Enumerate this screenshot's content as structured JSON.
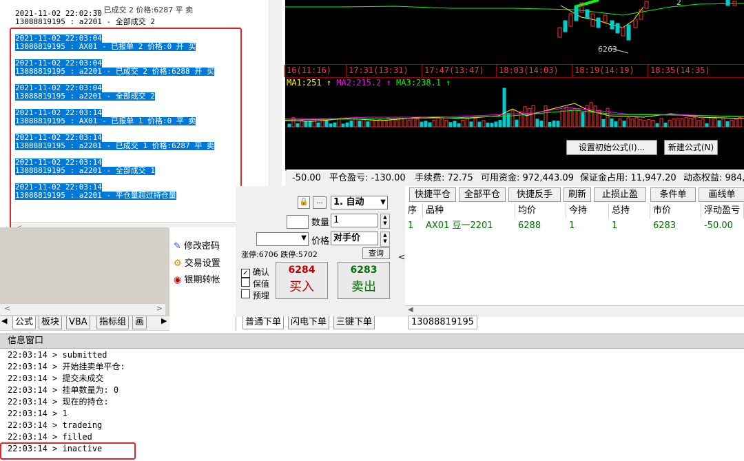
{
  "log_window": {
    "partial_line": "— 已成交 2 价格:6287 平 卖",
    "lines": [
      {
        "time": "2021-11-02 22:02:30",
        "msg": "13088819195 : a2201 - 全部成交 2",
        "selected": false
      },
      {
        "time": "2021-11-02 22:03:04",
        "msg": "13088819195 : AX01 - 已报单 2 价格:0 开 买",
        "selected": true
      },
      {
        "time": "2021-11-02 22:03:04",
        "msg": "13088819195 : a2201 - 已成交 2 价格:6288 开 买",
        "selected": true
      },
      {
        "time": "2021-11-02 22:03:04",
        "msg": "13088819195 : a2201 - 全部成交 2",
        "selected": true
      },
      {
        "time": "2021-11-02 22:03:14",
        "msg": "13088819195 : AX01 - 已报单 1 价格:0 平 卖",
        "selected": true
      },
      {
        "time": "2021-11-02 22:03:14",
        "msg": "13088819195 : a2201 - 已成交 1 价格:6287 平 卖",
        "selected": true
      },
      {
        "time": "2021-11-02 22:03:14",
        "msg": "13088819195 : a2201 - 全部成交 1",
        "selected": true
      },
      {
        "time": "2021-11-02 22:03:14",
        "msg": "13088819195 : a2201 - 平仓量超过持仓量",
        "selected": true
      }
    ]
  },
  "chart": {
    "time_labels": [
      "16(11:16)",
      "17:31(13:31)",
      "17:47(13:47)",
      "18:03(14:03)",
      "18:19(14:19)",
      "18:35(14:35)"
    ],
    "price_labels": [
      "6263",
      "2"
    ],
    "ma": [
      {
        "label": "MA1:251",
        "color": "#ffff00"
      },
      {
        "label": "MA2:215.2",
        "color": "#ff00ff"
      },
      {
        "label": "MA3:238.1",
        "color": "#00ff00"
      }
    ],
    "buttons": {
      "init_formula": "设置初始公式(I)...",
      "new_formula": "新建公式(N)"
    }
  },
  "status_bar": {
    "float_pnl": "-50.00",
    "close_pnl": "平仓盈亏: -130.00",
    "fee": "手续费: 72.75",
    "available": "可用资金: 972,443.09",
    "margin": "保证金占用: 11,947.20",
    "equity": "动态权益: 984,"
  },
  "left_tabs": [
    "公式",
    "板块",
    "VBA",
    "指标组",
    "画"
  ],
  "menu": {
    "items": [
      "修改密码",
      "交易设置",
      "银期转帐"
    ]
  },
  "order_panel": {
    "mode": "1. 自动",
    "qty_label": "数量",
    "qty_value": "1",
    "price_label": "价格",
    "price_value": "对手价",
    "limit_text": "涨停:6706 跌停:5702",
    "query_button": "查询",
    "confirm": "确认",
    "hedge": "保值",
    "preorder": "预埋",
    "buy_price": "6284",
    "buy_label": "买入",
    "sell_price": "6283",
    "sell_label": "卖出",
    "tabs": [
      "普通下单",
      "闪电下单",
      "三键下单"
    ]
  },
  "positions": {
    "buttons": [
      "快捷平仓",
      "全部平仓",
      "快捷反手",
      "刷新",
      "止损止盈",
      "条件单",
      "画线单"
    ],
    "columns": [
      "序",
      "品种",
      "均价",
      "今持",
      "总持",
      "市价",
      "浮动盈亏"
    ],
    "rows": [
      [
        "1",
        "AX01 豆一2201",
        "6288",
        "1",
        "1",
        "6283",
        "-50.00"
      ]
    ],
    "account_tab": "13088819195"
  },
  "info_window": {
    "title": "信息窗口",
    "lines": [
      "22:03:14 > submitted",
      "22:03:14 > 开始挂卖单平仓:",
      "22:03:14 > 提交未成交",
      "22:03:14 > 挂单数量为: 0",
      "22:03:14 > 现在的持仓:",
      "22:03:14 > 1",
      "22:03:14 > tradeing",
      "22:03:14 > filled",
      "22:03:14 > inactive"
    ]
  },
  "colors": {
    "highlight": "#0078d7",
    "annotation": "#e8222b",
    "up": "#ff3333",
    "down": "#00cccc"
  }
}
